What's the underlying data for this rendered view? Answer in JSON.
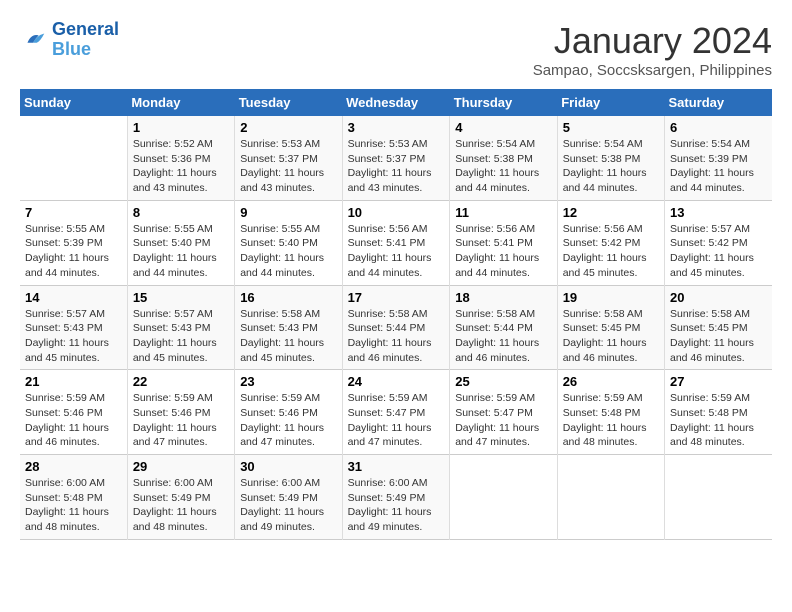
{
  "logo": {
    "line1": "General",
    "line2": "Blue"
  },
  "title": "January 2024",
  "subtitle": "Sampao, Soccsksargen, Philippines",
  "days_header": [
    "Sunday",
    "Monday",
    "Tuesday",
    "Wednesday",
    "Thursday",
    "Friday",
    "Saturday"
  ],
  "weeks": [
    [
      {
        "day": "",
        "info": ""
      },
      {
        "day": "1",
        "info": "Sunrise: 5:52 AM\nSunset: 5:36 PM\nDaylight: 11 hours\nand 43 minutes."
      },
      {
        "day": "2",
        "info": "Sunrise: 5:53 AM\nSunset: 5:37 PM\nDaylight: 11 hours\nand 43 minutes."
      },
      {
        "day": "3",
        "info": "Sunrise: 5:53 AM\nSunset: 5:37 PM\nDaylight: 11 hours\nand 43 minutes."
      },
      {
        "day": "4",
        "info": "Sunrise: 5:54 AM\nSunset: 5:38 PM\nDaylight: 11 hours\nand 44 minutes."
      },
      {
        "day": "5",
        "info": "Sunrise: 5:54 AM\nSunset: 5:38 PM\nDaylight: 11 hours\nand 44 minutes."
      },
      {
        "day": "6",
        "info": "Sunrise: 5:54 AM\nSunset: 5:39 PM\nDaylight: 11 hours\nand 44 minutes."
      }
    ],
    [
      {
        "day": "7",
        "info": "Sunrise: 5:55 AM\nSunset: 5:39 PM\nDaylight: 11 hours\nand 44 minutes."
      },
      {
        "day": "8",
        "info": "Sunrise: 5:55 AM\nSunset: 5:40 PM\nDaylight: 11 hours\nand 44 minutes."
      },
      {
        "day": "9",
        "info": "Sunrise: 5:55 AM\nSunset: 5:40 PM\nDaylight: 11 hours\nand 44 minutes."
      },
      {
        "day": "10",
        "info": "Sunrise: 5:56 AM\nSunset: 5:41 PM\nDaylight: 11 hours\nand 44 minutes."
      },
      {
        "day": "11",
        "info": "Sunrise: 5:56 AM\nSunset: 5:41 PM\nDaylight: 11 hours\nand 44 minutes."
      },
      {
        "day": "12",
        "info": "Sunrise: 5:56 AM\nSunset: 5:42 PM\nDaylight: 11 hours\nand 45 minutes."
      },
      {
        "day": "13",
        "info": "Sunrise: 5:57 AM\nSunset: 5:42 PM\nDaylight: 11 hours\nand 45 minutes."
      }
    ],
    [
      {
        "day": "14",
        "info": "Sunrise: 5:57 AM\nSunset: 5:43 PM\nDaylight: 11 hours\nand 45 minutes."
      },
      {
        "day": "15",
        "info": "Sunrise: 5:57 AM\nSunset: 5:43 PM\nDaylight: 11 hours\nand 45 minutes."
      },
      {
        "day": "16",
        "info": "Sunrise: 5:58 AM\nSunset: 5:43 PM\nDaylight: 11 hours\nand 45 minutes."
      },
      {
        "day": "17",
        "info": "Sunrise: 5:58 AM\nSunset: 5:44 PM\nDaylight: 11 hours\nand 46 minutes."
      },
      {
        "day": "18",
        "info": "Sunrise: 5:58 AM\nSunset: 5:44 PM\nDaylight: 11 hours\nand 46 minutes."
      },
      {
        "day": "19",
        "info": "Sunrise: 5:58 AM\nSunset: 5:45 PM\nDaylight: 11 hours\nand 46 minutes."
      },
      {
        "day": "20",
        "info": "Sunrise: 5:58 AM\nSunset: 5:45 PM\nDaylight: 11 hours\nand 46 minutes."
      }
    ],
    [
      {
        "day": "21",
        "info": "Sunrise: 5:59 AM\nSunset: 5:46 PM\nDaylight: 11 hours\nand 46 minutes."
      },
      {
        "day": "22",
        "info": "Sunrise: 5:59 AM\nSunset: 5:46 PM\nDaylight: 11 hours\nand 47 minutes."
      },
      {
        "day": "23",
        "info": "Sunrise: 5:59 AM\nSunset: 5:46 PM\nDaylight: 11 hours\nand 47 minutes."
      },
      {
        "day": "24",
        "info": "Sunrise: 5:59 AM\nSunset: 5:47 PM\nDaylight: 11 hours\nand 47 minutes."
      },
      {
        "day": "25",
        "info": "Sunrise: 5:59 AM\nSunset: 5:47 PM\nDaylight: 11 hours\nand 47 minutes."
      },
      {
        "day": "26",
        "info": "Sunrise: 5:59 AM\nSunset: 5:48 PM\nDaylight: 11 hours\nand 48 minutes."
      },
      {
        "day": "27",
        "info": "Sunrise: 5:59 AM\nSunset: 5:48 PM\nDaylight: 11 hours\nand 48 minutes."
      }
    ],
    [
      {
        "day": "28",
        "info": "Sunrise: 6:00 AM\nSunset: 5:48 PM\nDaylight: 11 hours\nand 48 minutes."
      },
      {
        "day": "29",
        "info": "Sunrise: 6:00 AM\nSunset: 5:49 PM\nDaylight: 11 hours\nand 48 minutes."
      },
      {
        "day": "30",
        "info": "Sunrise: 6:00 AM\nSunset: 5:49 PM\nDaylight: 11 hours\nand 49 minutes."
      },
      {
        "day": "31",
        "info": "Sunrise: 6:00 AM\nSunset: 5:49 PM\nDaylight: 11 hours\nand 49 minutes."
      },
      {
        "day": "",
        "info": ""
      },
      {
        "day": "",
        "info": ""
      },
      {
        "day": "",
        "info": ""
      }
    ]
  ]
}
